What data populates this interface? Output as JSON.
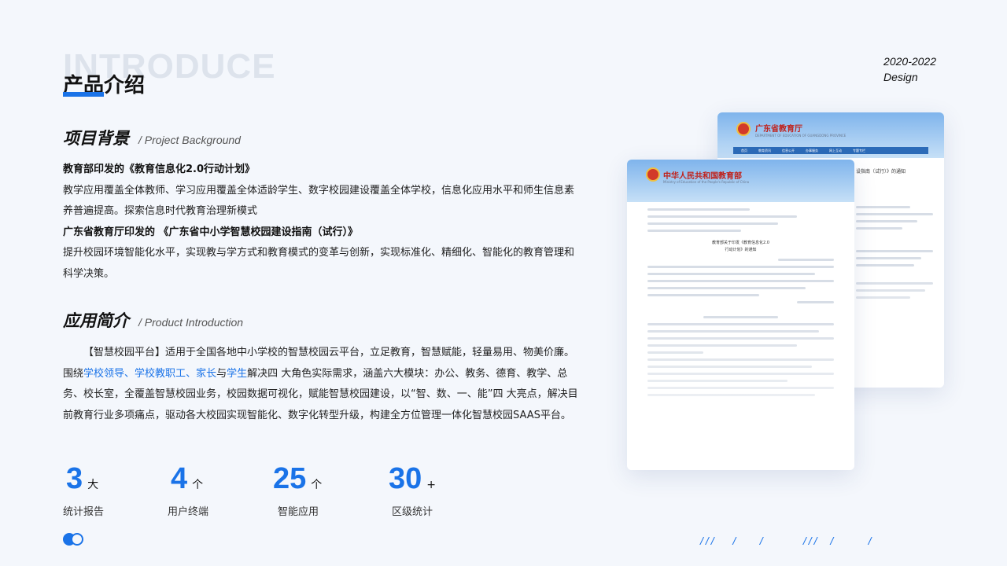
{
  "header": {
    "watermark": "INTRODUCE",
    "title": "产品介绍",
    "year": "2020-2022",
    "design": "Design"
  },
  "background_section": {
    "title_cn": "项目背景",
    "title_en": "/ Project Background",
    "item1_heading": "教育部印发的《教育信息化2.0行动计划》",
    "item1_text": "教学应用覆盖全体教师、学习应用覆盖全体适龄学生、数字校园建设覆盖全体学校，信息化应用水平和师生信息素养普遍提高。探索信息时代教育治理新模式",
    "item2_heading": "广东省教育厅印发的 《广东省中小学智慧校园建设指南（试行）》",
    "item2_text": "提升校园环境智能化水平，实现教与学方式和教育模式的变革与创新，实现标准化、精细化、智能化的教育管理和科学决策。"
  },
  "product_section": {
    "title_cn": "应用简介",
    "title_en": "/ Product Introduction",
    "p_a": "【智慧校园平台】适用于全国各地中小学校的智慧校园云平台，立足教育，智慧赋能，轻量易用、物美价廉。围绕",
    "hl_1": "学校领导",
    "sep_1": "、",
    "hl_2": "学校教职工",
    "sep_2": "、",
    "hl_3": "家长",
    "sep_3": "与",
    "hl_4": "学生",
    "p_b": "解决四 大角色实际需求，涵盖六大模块：办公、教务、德育、教学、总务、校长室，全覆盖智慧校园业务，校园数据可视化，赋能智慧校园建设，以“智、数、一、能”四 大亮点，解决目前教育行业多项痛点，驱动各大校园实现智能化、数字化转型升级，构建全方位管理一体化智慧校园SAAS平台。"
  },
  "stats": [
    {
      "num": "3",
      "unit": "大",
      "label": "统计报告"
    },
    {
      "num": "4",
      "unit": "个",
      "label": "用户终端"
    },
    {
      "num": "25",
      "unit": "个",
      "label": "智能应用"
    },
    {
      "num": "30",
      "unit": "+",
      "label": "区级统计"
    }
  ],
  "decor": {
    "slashes": "///   /    /       ///  /      /"
  },
  "doc_back": {
    "title": "广东省教育厅",
    "subtitle": "DEPARTMENT OF EDUCATION OF GUANGDONG PROVINCE",
    "nav": [
      "首页",
      "教育资讯",
      "信息公开",
      "办事服务",
      "网上互动",
      "专题专栏"
    ],
    "snippet": "设指南（试行）》的通知"
  },
  "doc_front": {
    "title": "中华人民共和国教育部",
    "subtitle": "Ministry of Education of the People's Republic of China",
    "doc_title_1": "教育部关于印发《教育信息化2.0",
    "doc_title_2": "行动计划》的通知"
  },
  "colors": {
    "accent": "#1a73e8",
    "background": "#f4f7fc",
    "text": "#222222"
  }
}
